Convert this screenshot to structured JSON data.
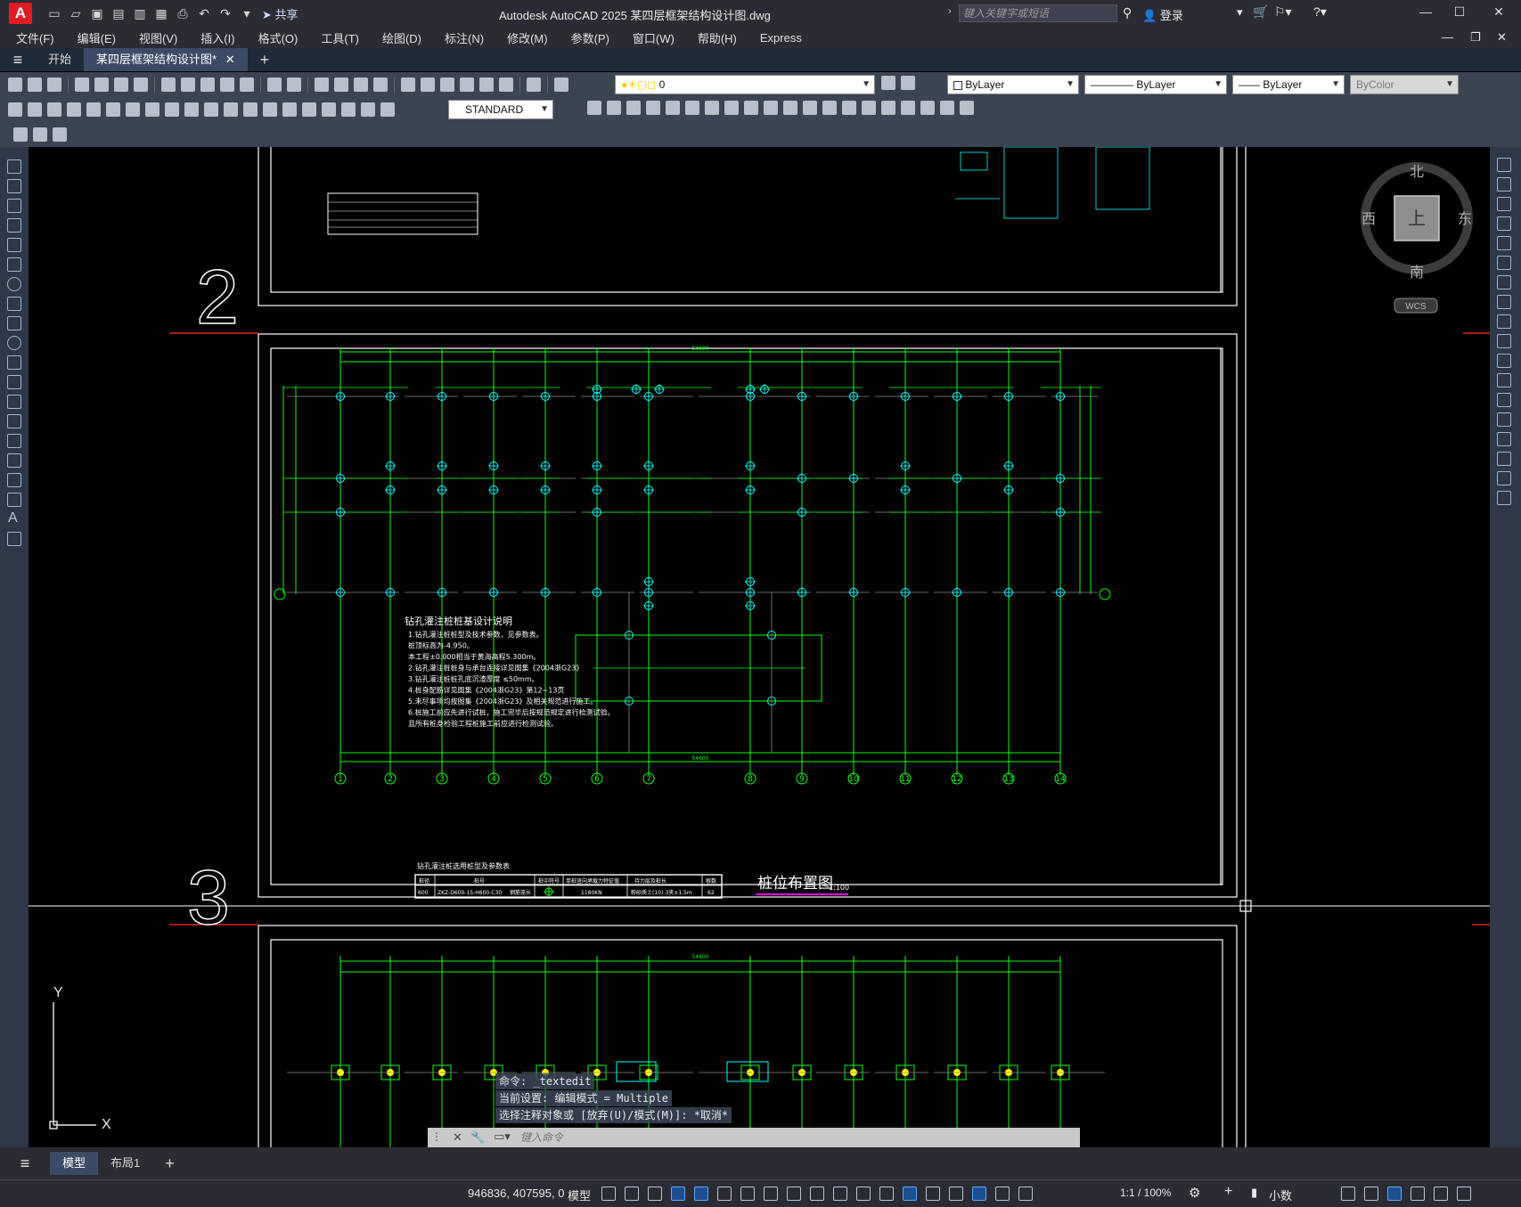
{
  "titlebar": {
    "app_letter": "A",
    "share_label": "共享",
    "title": "Autodesk AutoCAD 2025    某四层框架结构设计图.dwg",
    "search_placeholder": "键入关键字或短语",
    "login_label": "登录"
  },
  "menu": [
    "文件(F)",
    "编辑(E)",
    "视图(V)",
    "插入(I)",
    "格式(O)",
    "工具(T)",
    "绘图(D)",
    "标注(N)",
    "修改(M)",
    "参数(P)",
    "窗口(W)",
    "帮助(H)",
    "Express"
  ],
  "tabs": [
    {
      "label": "开始"
    },
    {
      "label": "某四层框架结构设计图*"
    }
  ],
  "toolbar": {
    "layer_value": "0",
    "text_style": "STANDARD",
    "color": "ByLayer",
    "linetype": "ByLayer",
    "lineweight": "ByLayer",
    "plotstyle": "ByColor"
  },
  "viewcube": {
    "north": "北",
    "south": "南",
    "east": "东",
    "west": "西",
    "face": "上",
    "wcs": "WCS"
  },
  "ucs": {
    "x": "X",
    "y": "Y"
  },
  "drawing": {
    "grid_numbers_large": [
      "2",
      "3"
    ],
    "plan_title": "桩位布置图",
    "plan_scale": "1:100",
    "notes_title": "钻孔灌注桩桩基设计说明",
    "notes": [
      "1.钻孔灌注桩桩型及技术参数，见参数表。",
      "  桩顶标高为-4.950。",
      "  本工程±0.000相当于黄海高程5.300m。",
      "2.钻孔灌注桩桩身与承台连接详见图集《2004浙G23》",
      "3.钻孔灌注桩桩孔底沉渣厚度 ≤50mm。",
      "4.桩身配筋详见图集《2004浙G23》第12~13页",
      "5.未尽事项均按图集《2004浙G23》及相关规范进行施工。",
      "6.桩施工前应先进行试桩，施工完毕后按规范规定进行检测试验。",
      "  且所有桩身检验工程桩施工前应进行检测试验。"
    ],
    "axis_labels": [
      "1",
      "2",
      "3",
      "4",
      "5",
      "6",
      "7",
      "8",
      "9",
      "10",
      "11",
      "12",
      "13",
      "14"
    ],
    "total_dim": "54600",
    "table": {
      "title": "钻孔灌注桩选用桩型及参数表",
      "headers": [
        "桩径",
        "桩号",
        "",
        "桩中符号",
        "单桩竖向承载力特征值",
        "持力层及桩长",
        "根数"
      ],
      "row": [
        "600",
        "ZKZ-D600-15-H600-C30",
        "钢筋笼长",
        "",
        "1180KN",
        "粉砂质土(10)-3夹±1.5m",
        "62"
      ]
    }
  },
  "command": {
    "line1": "命令: _textedit",
    "line2": "当前设置: 编辑模式 = Multiple",
    "line3": "选择注释对象或 [放弃(U)/模式(M)]: *取消*",
    "input_placeholder": "键入命令"
  },
  "layouts": [
    {
      "label": "模型"
    },
    {
      "label": "布局1"
    }
  ],
  "status": {
    "coords": "946836, 407595, 0",
    "model": "模型",
    "scale": "1:1 / 100%",
    "units": "小数"
  }
}
